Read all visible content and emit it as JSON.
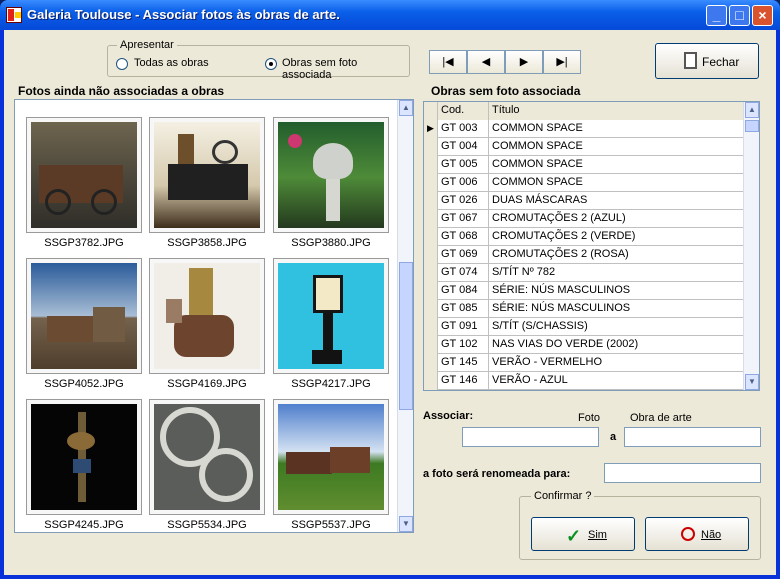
{
  "window": {
    "title": "Galeria Toulouse -  Associar fotos às obras de arte."
  },
  "apresentar": {
    "label": "Apresentar",
    "options": [
      {
        "label": "Todas as obras",
        "selected": false
      },
      {
        "label": "Obras sem foto associada",
        "selected": true
      }
    ]
  },
  "navigation": {
    "first": "|◀",
    "prev": "◀",
    "next": "▶",
    "last": "▶|"
  },
  "buttons": {
    "fechar": "Fechar",
    "sim": "Sim",
    "nao": "Não"
  },
  "photos": {
    "heading": "Fotos ainda não associadas a obras",
    "items": [
      {
        "filename": "SSGP3782.JPG",
        "icon": "wagon-photo"
      },
      {
        "filename": "SSGP3858.JPG",
        "icon": "antique-machine-photo"
      },
      {
        "filename": "SSGP3880.JPG",
        "icon": "stone-urn-photo"
      },
      {
        "filename": "SSGP4052.JPG",
        "icon": "old-wagons-photo"
      },
      {
        "filename": "SSGP4169.JPG",
        "icon": "table-objects-photo"
      },
      {
        "filename": "SSGP4217.JPG",
        "icon": "street-lamp-photo"
      },
      {
        "filename": "SSGP4245.JPG",
        "icon": "ornament-photo"
      },
      {
        "filename": "SSGP5534.JPG",
        "icon": "wheels-photo"
      },
      {
        "filename": "SSGP5537.JPG",
        "icon": "rusty-machines-photo"
      }
    ]
  },
  "obras": {
    "heading": "Obras sem foto associada",
    "columns": [
      "Cod.",
      "Título"
    ],
    "rows": [
      {
        "cod": "GT 003",
        "titulo": "COMMON SPACE",
        "current": true
      },
      {
        "cod": "GT 004",
        "titulo": "COMMON SPACE"
      },
      {
        "cod": "GT 005",
        "titulo": "COMMON SPACE"
      },
      {
        "cod": "GT 006",
        "titulo": "COMMON SPACE"
      },
      {
        "cod": "GT 026",
        "titulo": "DUAS MÁSCARAS"
      },
      {
        "cod": "GT 067",
        "titulo": "CROMUTAÇÕES 2 (AZUL)"
      },
      {
        "cod": "GT 068",
        "titulo": "CROMUTAÇÕES 2 (VERDE)"
      },
      {
        "cod": "GT 069",
        "titulo": "CROMUTAÇÕES 2 (ROSA)"
      },
      {
        "cod": "GT 074",
        "titulo": "S/TÍT Nº 782"
      },
      {
        "cod": "GT 084",
        "titulo": "SÉRIE: NÚS MASCULINOS"
      },
      {
        "cod": "GT 085",
        "titulo": "SÉRIE: NÚS MASCULINOS"
      },
      {
        "cod": "GT 091",
        "titulo": "S/TÍT (S/CHASSIS)"
      },
      {
        "cod": "GT 102",
        "titulo": "NAS VIAS DO VERDE (2002)"
      },
      {
        "cod": "GT 145",
        "titulo": "VERÃO - VERMELHO"
      },
      {
        "cod": "GT 146",
        "titulo": "VERÃO - AZUL"
      }
    ]
  },
  "associar": {
    "label": "Associar:",
    "foto_label": "Foto",
    "a_label": "a",
    "obra_label": "Obra de arte",
    "foto_value": "",
    "obra_value": "",
    "rename_label": "a foto será renomeada para:",
    "rename_value": ""
  },
  "confirmar": {
    "label": "Confirmar ?"
  }
}
